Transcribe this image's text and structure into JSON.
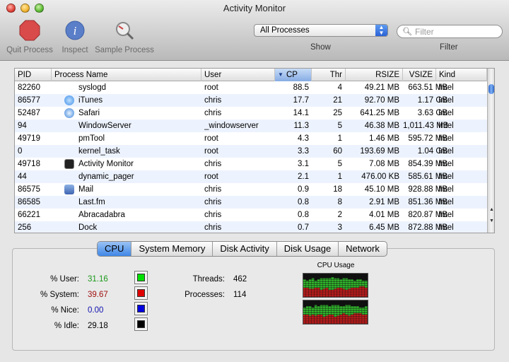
{
  "window": {
    "title": "Activity Monitor"
  },
  "toolbar": {
    "quit_label": "Quit Process",
    "inspect_label": "Inspect",
    "sample_label": "Sample Process",
    "process_filter_value": "All Processes",
    "show_label": "Show",
    "filter_placeholder": "Filter",
    "filter_label": "Filter"
  },
  "table": {
    "columns": [
      "PID",
      "Process Name",
      "User",
      "CP",
      "Thr",
      "RSIZE",
      "VSIZE",
      "Kind"
    ],
    "sorted_column": "CP",
    "rows": [
      {
        "pid": "82260",
        "name": "syslogd",
        "user": "root",
        "cpu": "88.5",
        "thr": "4",
        "rsize": "49.21 MB",
        "vsize": "663.51 MB",
        "kind": "Intel",
        "icon": "none"
      },
      {
        "pid": "86577",
        "name": "iTunes",
        "user": "chris",
        "cpu": "17.7",
        "thr": "21",
        "rsize": "92.70 MB",
        "vsize": "1.17 GB",
        "kind": "Intel",
        "icon": "itunes-icon"
      },
      {
        "pid": "52487",
        "name": "Safari",
        "user": "chris",
        "cpu": "14.1",
        "thr": "25",
        "rsize": "641.25 MB",
        "vsize": "3.63 GB",
        "kind": "Intel",
        "icon": "safari-icon"
      },
      {
        "pid": "94",
        "name": "WindowServer",
        "user": "_windowserver",
        "cpu": "11.3",
        "thr": "5",
        "rsize": "46.38 MB",
        "vsize": "1,011.43 MB",
        "kind": "Intel",
        "icon": "none"
      },
      {
        "pid": "49719",
        "name": "pmTool",
        "user": "root",
        "cpu": "4.3",
        "thr": "1",
        "rsize": "1.46 MB",
        "vsize": "595.72 MB",
        "kind": "Intel",
        "icon": "none"
      },
      {
        "pid": "0",
        "name": "kernel_task",
        "user": "root",
        "cpu": "3.3",
        "thr": "60",
        "rsize": "193.69 MB",
        "vsize": "1.04 GB",
        "kind": "Intel",
        "icon": "none"
      },
      {
        "pid": "49718",
        "name": "Activity Monitor",
        "user": "chris",
        "cpu": "3.1",
        "thr": "5",
        "rsize": "7.08 MB",
        "vsize": "854.39 MB",
        "kind": "Intel",
        "icon": "activity-monitor-icon"
      },
      {
        "pid": "44",
        "name": "dynamic_pager",
        "user": "root",
        "cpu": "2.1",
        "thr": "1",
        "rsize": "476.00 KB",
        "vsize": "585.61 MB",
        "kind": "Intel",
        "icon": "none"
      },
      {
        "pid": "86575",
        "name": "Mail",
        "user": "chris",
        "cpu": "0.9",
        "thr": "18",
        "rsize": "45.10 MB",
        "vsize": "928.88 MB",
        "kind": "Intel",
        "icon": "mail-icon"
      },
      {
        "pid": "86585",
        "name": "Last.fm",
        "user": "chris",
        "cpu": "0.8",
        "thr": "8",
        "rsize": "2.91 MB",
        "vsize": "851.36 MB",
        "kind": "Intel",
        "icon": "none"
      },
      {
        "pid": "66221",
        "name": "Abracadabra",
        "user": "chris",
        "cpu": "0.8",
        "thr": "2",
        "rsize": "4.01 MB",
        "vsize": "820.87 MB",
        "kind": "Intel",
        "icon": "none"
      },
      {
        "pid": "256",
        "name": "Dock",
        "user": "chris",
        "cpu": "0.7",
        "thr": "3",
        "rsize": "6.45 MB",
        "vsize": "872.88 MB",
        "kind": "Intel",
        "icon": "none"
      }
    ]
  },
  "tabs": [
    "CPU",
    "System Memory",
    "Disk Activity",
    "Disk Usage",
    "Network"
  ],
  "active_tab": "CPU",
  "cpu": {
    "user_label": "% User:",
    "user_value": "31.16",
    "user_color": "#1a9a1a",
    "system_label": "% System:",
    "system_value": "39.67",
    "system_color": "#a01010",
    "nice_label": "% Nice:",
    "nice_value": "0.00",
    "nice_color": "#1010b0",
    "idle_label": "% Idle:",
    "idle_value": "29.18",
    "threads_label": "Threads:",
    "threads_value": "462",
    "processes_label": "Processes:",
    "processes_value": "114",
    "graph_title": "CPU Usage",
    "swatch_colors": {
      "user": "#00e000",
      "system": "#e00000",
      "nice": "#0000e0",
      "idle": "#000000"
    },
    "core1_history": {
      "user": [
        0.35,
        0.3,
        0.4,
        0.45,
        0.3,
        0.35,
        0.5,
        0.45,
        0.4,
        0.5,
        0.55,
        0.45,
        0.4,
        0.35,
        0.45,
        0.5,
        0.4,
        0.35,
        0.3,
        0.35,
        0.3,
        0.25,
        0.3
      ],
      "system": [
        0.4,
        0.4,
        0.35,
        0.35,
        0.4,
        0.4,
        0.3,
        0.35,
        0.4,
        0.3,
        0.3,
        0.35,
        0.4,
        0.4,
        0.35,
        0.3,
        0.35,
        0.4,
        0.4,
        0.4,
        0.45,
        0.45,
        0.4
      ]
    },
    "core2_history": {
      "user": [
        0.3,
        0.35,
        0.4,
        0.3,
        0.45,
        0.35,
        0.4,
        0.5,
        0.45,
        0.35,
        0.4,
        0.5,
        0.45,
        0.35,
        0.3,
        0.4,
        0.45,
        0.35,
        0.3,
        0.3,
        0.25,
        0.3,
        0.35
      ],
      "system": [
        0.4,
        0.4,
        0.35,
        0.4,
        0.35,
        0.4,
        0.4,
        0.3,
        0.35,
        0.4,
        0.4,
        0.3,
        0.35,
        0.4,
        0.45,
        0.4,
        0.35,
        0.4,
        0.45,
        0.45,
        0.45,
        0.4,
        0.4
      ]
    }
  }
}
